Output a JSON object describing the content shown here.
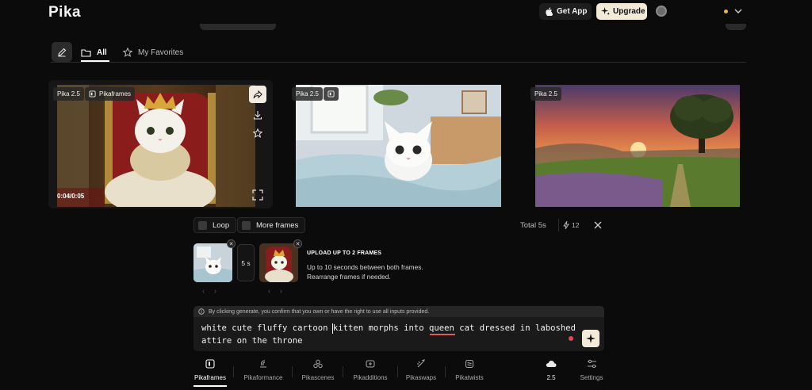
{
  "app": {
    "logo": "Pika"
  },
  "header": {
    "get_app": "Get App",
    "upgrade": "Upgrade"
  },
  "filters": {
    "all": "All",
    "favorites": "My Favorites"
  },
  "cards": [
    {
      "model": "Pika 2.5",
      "tag": "Pikaframes",
      "timecode": "0:04/0:05"
    },
    {
      "model": "Pika 2.5"
    },
    {
      "model": "Pika 2.5"
    }
  ],
  "panel": {
    "loop": "Loop",
    "more_frames": "More frames",
    "total": "Total 5s",
    "credits": "12",
    "duration": "5 s",
    "upload_title": "UPLOAD UP TO 2 FRAMES",
    "upload_line1": "Up to 10 seconds between both frames.",
    "upload_line2": "Rearrange frames if needed.",
    "consent": "By clicking generate, you confirm that you own or have the right to use all inputs provided.",
    "prompt_line1": "white cute fluffy cartoon kitten morphs into queen cat dressed in laboshed",
    "prompt_line2": "attire on the throne"
  },
  "nav": [
    {
      "label": "Pikaframes",
      "icon": "frames-icon"
    },
    {
      "label": "Pikaformance",
      "icon": "performance-icon"
    },
    {
      "label": "Pikascenes",
      "icon": "scenes-icon"
    },
    {
      "label": "Pikadditions",
      "icon": "additions-icon"
    },
    {
      "label": "Pikaswaps",
      "icon": "swaps-icon"
    },
    {
      "label": "Pikatwists",
      "icon": "twists-icon"
    },
    {
      "label": "2.5",
      "icon": "cloud-icon"
    },
    {
      "label": "Settings",
      "icon": "sliders-icon"
    }
  ],
  "colors": {
    "accent": "#f3ead8",
    "background": "#0b0b0b",
    "record": "#e0484f"
  }
}
